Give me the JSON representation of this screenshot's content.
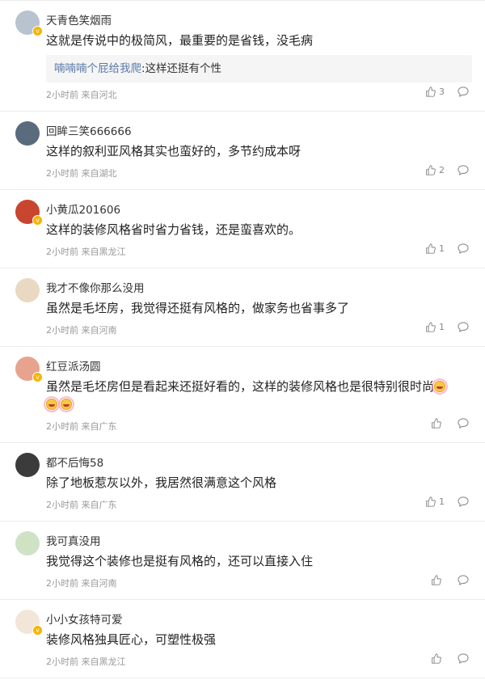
{
  "comments": [
    {
      "name": "天青色笑烟雨",
      "text": "这就是传说中的极简风，最重要的是省钱，没毛病",
      "reply": {
        "name": "喃喃喃个屁给我爬",
        "text": ":这样还挺有个性"
      },
      "time": "2小时前",
      "location": "来自河北",
      "likes": "3",
      "avatar_color": "#b9c3cf",
      "verified": true
    },
    {
      "name": "回眸三笑666666",
      "text": "这样的叙利亚风格其实也蛮好的，多节约成本呀",
      "time": "2小时前",
      "location": "来自湖北",
      "likes": "2",
      "avatar_color": "#5a6b7d",
      "verified": false
    },
    {
      "name": "小黄瓜201606",
      "text": "这样的装修风格省时省力省钱，还是蛮喜欢的。",
      "time": "2小时前",
      "location": "来自黑龙江",
      "likes": "1",
      "avatar_color": "#c8452f",
      "verified": true
    },
    {
      "name": "我才不像你那么没用",
      "text": "虽然是毛坯房，我觉得还挺有风格的，做家务也省事多了",
      "time": "2小时前",
      "location": "来自河南",
      "likes": "1",
      "avatar_color": "#e9d9c2",
      "verified": false
    },
    {
      "name": "红豆派汤圆",
      "text": "虽然是毛坯房但是看起来还挺好看的，这样的装修风格也是很特别很时尚",
      "time": "2小时前",
      "location": "来自广东",
      "likes": "",
      "avatar_color": "#e8a38f",
      "verified": true,
      "emoji_count": 3
    },
    {
      "name": "都不后悔58",
      "text": "除了地板惹灰以外，我居然很满意这个风格",
      "time": "2小时前",
      "location": "来自广东",
      "likes": "1",
      "avatar_color": "#3b3b3b",
      "verified": false
    },
    {
      "name": "我可真没用",
      "text": "我觉得这个装修也是挺有风格的，还可以直接入住",
      "time": "2小时前",
      "location": "来自河南",
      "likes": "",
      "avatar_color": "#cfe3c4",
      "verified": false
    },
    {
      "name": "小小女孩特可爱",
      "text": "装修风格独具匠心，可塑性极强",
      "time": "2小时前",
      "location": "来自黑龙江",
      "likes": "",
      "avatar_color": "#f1e6d8",
      "verified": true
    }
  ]
}
